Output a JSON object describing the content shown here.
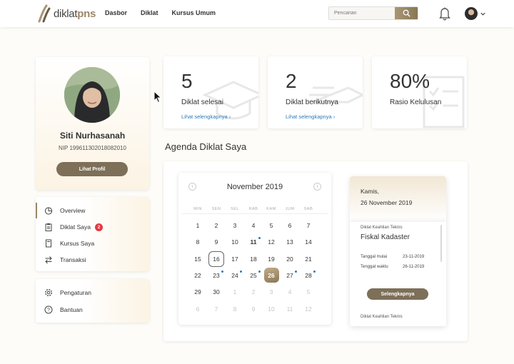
{
  "brand": {
    "name_light": "diklat",
    "name_bold": "pns",
    "accent": "#9b8866",
    "button_color": "#7d6f58",
    "link_color": "#2a7bbd"
  },
  "nav": {
    "items": [
      "Dasbor",
      "Diklat",
      "Kursus Umum"
    ]
  },
  "search": {
    "placeholder": "Pencarian"
  },
  "profile": {
    "name": "Siti Nurhasanah",
    "nip": "NIP 199611302018082010",
    "button": "Lihat Profil"
  },
  "menu": {
    "items": [
      {
        "label": "Overview",
        "icon": "pie-chart-icon",
        "active": true
      },
      {
        "label": "Diklat Saya",
        "icon": "clipboard-icon",
        "badge": "2"
      },
      {
        "label": "Kursus Saya",
        "icon": "document-icon"
      },
      {
        "label": "Transaksi",
        "icon": "exchange-icon"
      }
    ],
    "settings": [
      {
        "label": "Pengaturan",
        "icon": "gear-icon"
      },
      {
        "label": "Bantuan",
        "icon": "help-icon"
      }
    ]
  },
  "stats": [
    {
      "value": "5",
      "label": "Diklat selesai",
      "link": "Lihat selengkapnya"
    },
    {
      "value": "2",
      "label": "Diklat berikutnya",
      "link": "Lihat selengkapnya"
    },
    {
      "value": "80%",
      "label": "Rasio Kelulusan"
    }
  ],
  "agenda": {
    "title": "Agenda Diklat Saya",
    "calendar": {
      "month": "November 2019",
      "weekdays": [
        "MIN",
        "SEN",
        "SEL",
        "RAB",
        "KAM",
        "JUM",
        "SAB"
      ],
      "weeks": [
        [
          "1",
          "2",
          "3",
          "4",
          "5",
          "6",
          "7"
        ],
        [
          "8",
          "9",
          "10",
          "11",
          "12",
          "13",
          "14"
        ],
        [
          "15",
          "16",
          "17",
          "18",
          "19",
          "20",
          "21"
        ],
        [
          "22",
          "23",
          "24",
          "25",
          "26",
          "27",
          "28"
        ],
        [
          "29",
          "30",
          "1",
          "2",
          "3",
          "4",
          "5"
        ],
        [
          "6",
          "7",
          "8",
          "9",
          "10",
          "11",
          "12"
        ]
      ],
      "today": "16",
      "selected": "26",
      "event_days": [
        "11",
        "23",
        "24",
        "25",
        "27",
        "28"
      ]
    },
    "detail": {
      "day": "Kamis,",
      "date": "26 November 2019",
      "event_type": "Diklat Keahlian Teknis",
      "event_name": "Fiskal Kadaster",
      "start_label": "Tanggal mulai",
      "start_value": "23-11-2019",
      "deadline_label": "Tenggat waktu",
      "deadline_value": "26-11-2019",
      "button": "Selengkapnya",
      "next_type": "Diklat Keahlian Teknis"
    }
  }
}
